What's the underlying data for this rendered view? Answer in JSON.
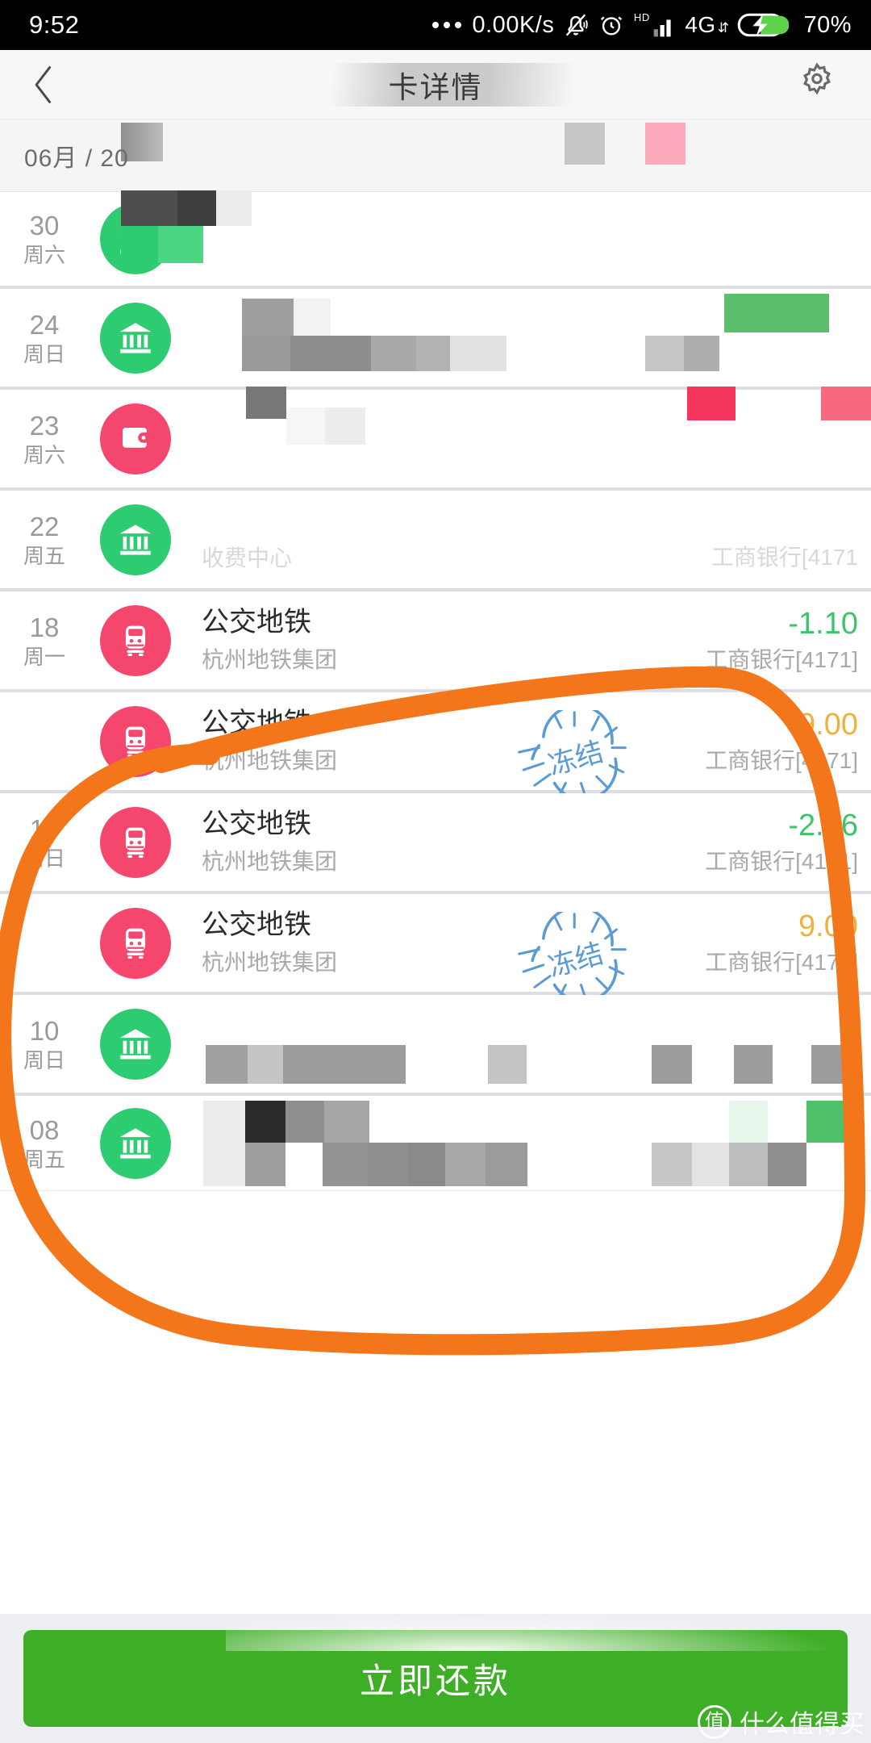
{
  "status_bar": {
    "time": "9:52",
    "net_speed": "0.00K/s",
    "network_type": "4G",
    "battery_percent": "70%",
    "icons": [
      "more-dots-icon",
      "silent-bell-icon",
      "alarm-clock-icon",
      "hd-icon",
      "signal-bars-icon",
      "data-arrows-icon",
      "battery-charging-icon"
    ]
  },
  "nav_bar": {
    "back_icon": "chevron-left-icon",
    "title": "卡详情",
    "settings_icon": "gear-icon"
  },
  "month_header": {
    "label": "06月 / 20"
  },
  "transactions": [
    {
      "day": "30",
      "weekday": "周六",
      "icon": "bank-icon",
      "icon_color": "#2ecc71",
      "title": "",
      "subtitle": "",
      "amount": "",
      "bank": "",
      "redacted": true
    },
    {
      "day": "24",
      "weekday": "周日",
      "icon": "bank-icon",
      "icon_color": "#2ecc71",
      "title": "",
      "subtitle": "",
      "amount": "",
      "bank": "",
      "redacted": true
    },
    {
      "day": "23",
      "weekday": "周六",
      "icon": "wallet-icon",
      "icon_color": "#f5476d",
      "title": "",
      "subtitle": "",
      "amount": "",
      "bank": "",
      "redacted": true
    },
    {
      "day": "22",
      "weekday": "周五",
      "icon": "bank-icon",
      "icon_color": "#2ecc71",
      "title": "",
      "subtitle": "收费中心",
      "amount": "",
      "bank": "工商银行[4171",
      "redacted": true
    },
    {
      "day": "18",
      "weekday": "周一",
      "icon": "metro-icon",
      "icon_color": "#f5476d",
      "title": "公交地铁",
      "subtitle": "杭州地铁集团",
      "amount": "-1.10",
      "amount_type": "negative",
      "bank": "工商银行[4171]",
      "redacted": false
    },
    {
      "day": "",
      "weekday": "",
      "icon": "metro-icon",
      "icon_color": "#f5476d",
      "title": "公交地铁",
      "subtitle": "杭州地铁集团",
      "amount": "9.00",
      "amount_type": "frozen",
      "stamp": "冻结",
      "bank": "工商银行[4171]",
      "redacted": false
    },
    {
      "day": "17",
      "weekday": "周日",
      "icon": "metro-icon",
      "icon_color": "#f5476d",
      "title": "公交地铁",
      "subtitle": "杭州地铁集团",
      "amount": "-2.46",
      "amount_type": "negative",
      "bank": "工商银行[4171]",
      "redacted": false
    },
    {
      "day": "",
      "weekday": "",
      "icon": "metro-icon",
      "icon_color": "#f5476d",
      "title": "公交地铁",
      "subtitle": "杭州地铁集团",
      "amount": "9.00",
      "amount_type": "frozen",
      "stamp": "冻结",
      "bank": "工商银行[4171]",
      "redacted": false
    },
    {
      "day": "10",
      "weekday": "周日",
      "icon": "bank-icon",
      "icon_color": "#2ecc71",
      "title": "",
      "subtitle": "",
      "amount": "",
      "bank": "",
      "redacted": true
    },
    {
      "day": "08",
      "weekday": "周五",
      "icon": "bank-icon",
      "icon_color": "#2ecc71",
      "title": "",
      "subtitle": "",
      "amount": "",
      "bank": "",
      "redacted": true
    }
  ],
  "footer": {
    "pay_button_label": "立即还款",
    "watermark_text": "什么值得买",
    "watermark_badge": "值"
  },
  "colors": {
    "accent_green": "#3eae26",
    "bank_icon_green": "#2ecc71",
    "metro_icon_pink": "#f5476d",
    "amount_negative": "#3cc46a",
    "amount_frozen": "#f0b03c",
    "stamp_blue": "#5b9bd5",
    "annotation_orange": "#f4761a"
  },
  "annotation": {
    "type": "hand-drawn-circle",
    "color": "#f4761a",
    "describes": "highlights the four 公交地铁 metro rows"
  }
}
